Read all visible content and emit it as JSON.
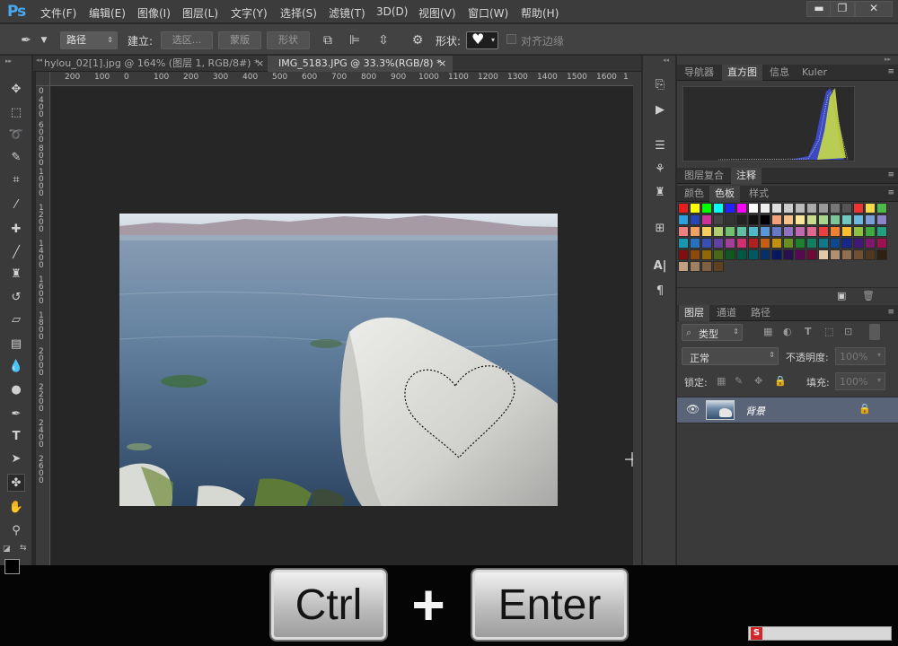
{
  "app": {
    "logo": "Ps"
  },
  "menu": [
    "文件(F)",
    "编辑(E)",
    "图像(I)",
    "图层(L)",
    "文字(Y)",
    "选择(S)",
    "滤镜(T)",
    "3D(D)",
    "视图(V)",
    "窗口(W)",
    "帮助(H)"
  ],
  "window_controls": {
    "minimize": "▬",
    "restore": "❐",
    "close": "✕"
  },
  "options": {
    "mode_value": "路径",
    "make_label": "建立:",
    "selection_btn": "选区...",
    "mask_btn": "蒙版",
    "shape_btn": "形状",
    "shape_label": "形状:",
    "align_edges": "对齐边缘"
  },
  "tabs": [
    {
      "label": "hylou_02[1].jpg @ 164% (图层 1, RGB/8#) *",
      "close": "×"
    },
    {
      "label": "IMG_5183.JPG @ 33.3%(RGB/8) *",
      "close": "×"
    }
  ],
  "ruler_h": [
    "200",
    "100",
    "0",
    "100",
    "200",
    "300",
    "400",
    "500",
    "600",
    "700",
    "800",
    "900",
    "1000",
    "1100",
    "1200",
    "1300",
    "1400",
    "1500",
    "1600",
    "1"
  ],
  "ruler_v": [
    "0",
    "4 0 0",
    "6 0 0",
    "8 0 0",
    "1 0 0 0",
    "1 2 0 0",
    "1 4 0 0",
    "1 6 0 0",
    "1 8 0 0",
    "2 0 0 0",
    "2 2 0 0",
    "2 4 0 0",
    "2 6 0 0"
  ],
  "panels": {
    "top_tabs": [
      "导航器",
      "直方图",
      "信息",
      "Kuler"
    ],
    "mid_tabs": [
      "图层复合",
      "注释"
    ],
    "swatch_tabs": [
      "颜色",
      "色板",
      "样式"
    ],
    "layers_tabs": [
      "图层",
      "通道",
      "路径"
    ],
    "filter_kind": "类型",
    "blend_mode": "正常",
    "opacity_label": "不透明度:",
    "opacity_value": "100%",
    "lock_label": "锁定:",
    "fill_label": "填充:",
    "fill_value": "100%",
    "layer_name": "背景"
  },
  "swatches": [
    "#e41e1e",
    "#ffff00",
    "#00ff00",
    "#00ffff",
    "#2323ff",
    "#ff00ff",
    "#ffffff",
    "#eeeeee",
    "#dddddd",
    "#cccccc",
    "#bbbbbb",
    "#aaaaaa",
    "#999999",
    "#777777",
    "#555555",
    "#ee3333",
    "#f5d94c",
    "#4eb94a",
    "#2f9fe0",
    "#2545b8",
    "#cc3399",
    "#444444",
    "#333333",
    "#222222",
    "#111111",
    "#000000",
    "#f4a07a",
    "#f7c088",
    "#fbe59a",
    "#c9dc8c",
    "#a8d68c",
    "#7bc598",
    "#70c8c0",
    "#6cb8e0",
    "#7c9ed8",
    "#8c84c8",
    "#f08080",
    "#f0a060",
    "#f8d060",
    "#b0d070",
    "#70c070",
    "#60c0a0",
    "#50b8c8",
    "#5898d8",
    "#6878c8",
    "#9070c0",
    "#c068b0",
    "#e06890",
    "#e84040",
    "#f08030",
    "#f8c030",
    "#90c040",
    "#40a840",
    "#20a080",
    "#1898b0",
    "#2870c0",
    "#3850b0",
    "#6040a0",
    "#a04098",
    "#d03070",
    "#b02020",
    "#c06010",
    "#c09010",
    "#689020",
    "#208030",
    "#108060",
    "#107888",
    "#104890",
    "#182888",
    "#401878",
    "#801870",
    "#a01050",
    "#801010",
    "#904808",
    "#906808",
    "#486818",
    "#105820",
    "#005840",
    "#005860",
    "#083068",
    "#081860",
    "#281050",
    "#580850",
    "#700838",
    "#e0c8a8",
    "#b09070",
    "#907050",
    "#705030",
    "#503820",
    "#302010",
    "#c0a080",
    "#a08060",
    "#806040",
    "#604020"
  ],
  "keys": {
    "ctrl": "Ctrl",
    "plus": "+",
    "enter": "Enter"
  }
}
